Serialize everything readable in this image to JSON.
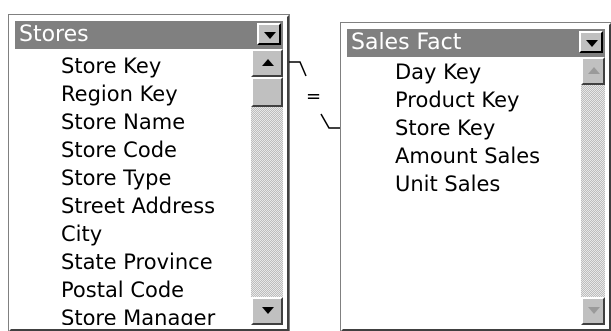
{
  "stores_table": {
    "title": "Stores",
    "fields": [
      "Store Key",
      "Region Key",
      "Store Name",
      "Store Code",
      "Store Type",
      "Street Address",
      "City",
      "State Province",
      "Postal Code",
      "Store Manager"
    ]
  },
  "sales_fact_table": {
    "title": "Sales Fact",
    "fields": [
      "Day Key",
      "Product Key",
      "Store Key",
      "Amount Sales",
      "Unit Sales"
    ]
  },
  "join": {
    "operator": "="
  },
  "icons": {
    "dropdown": "chevron-down-icon",
    "scroll_up": "scroll-up-arrow-icon",
    "scroll_down": "scroll-down-arrow-icon"
  }
}
